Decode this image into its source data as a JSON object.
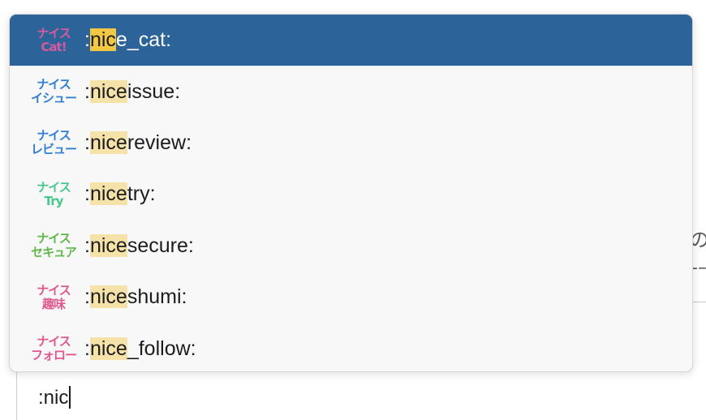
{
  "autocomplete": {
    "query_match": "nic",
    "items": [
      {
        "label_prefix": ":",
        "label_match": "nic",
        "label_rest": "e_cat:",
        "emoji_top": "ナイス",
        "emoji_bottom": "Cat!",
        "emoji_color": "#d75a9f",
        "selected": true
      },
      {
        "label_prefix": ":",
        "label_match": "nice",
        "label_rest": "issue:",
        "emoji_top": "ナイス",
        "emoji_bottom": "イシュー",
        "emoji_color": "#2f7fd4",
        "selected": false
      },
      {
        "label_prefix": ":",
        "label_match": "nice",
        "label_rest": "review:",
        "emoji_top": "ナイス",
        "emoji_bottom": "レビュー",
        "emoji_color": "#2f7fd4",
        "selected": false
      },
      {
        "label_prefix": ":",
        "label_match": "nice",
        "label_rest": "try:",
        "emoji_top": "ナイス",
        "emoji_bottom": "Try",
        "emoji_color": "#46c98a",
        "selected": false
      },
      {
        "label_prefix": ":",
        "label_match": "nice",
        "label_rest": "secure:",
        "emoji_top": "ナイス",
        "emoji_bottom": "セキュア",
        "emoji_color": "#5fb84a",
        "selected": false
      },
      {
        "label_prefix": ":",
        "label_match": "nice",
        "label_rest": "shumi:",
        "emoji_top": "ナイス",
        "emoji_bottom": "趣味",
        "emoji_color": "#e0588f",
        "selected": false
      },
      {
        "label_prefix": ":",
        "label_match": "nice",
        "label_rest": "_follow:",
        "emoji_top": "ナイス",
        "emoji_bottom": "フォロー",
        "emoji_color": "#e0588f",
        "selected": false
      }
    ]
  },
  "composer": {
    "value": ":nic"
  },
  "background": {
    "glyph_1": "の",
    "glyph_2": "-–"
  }
}
